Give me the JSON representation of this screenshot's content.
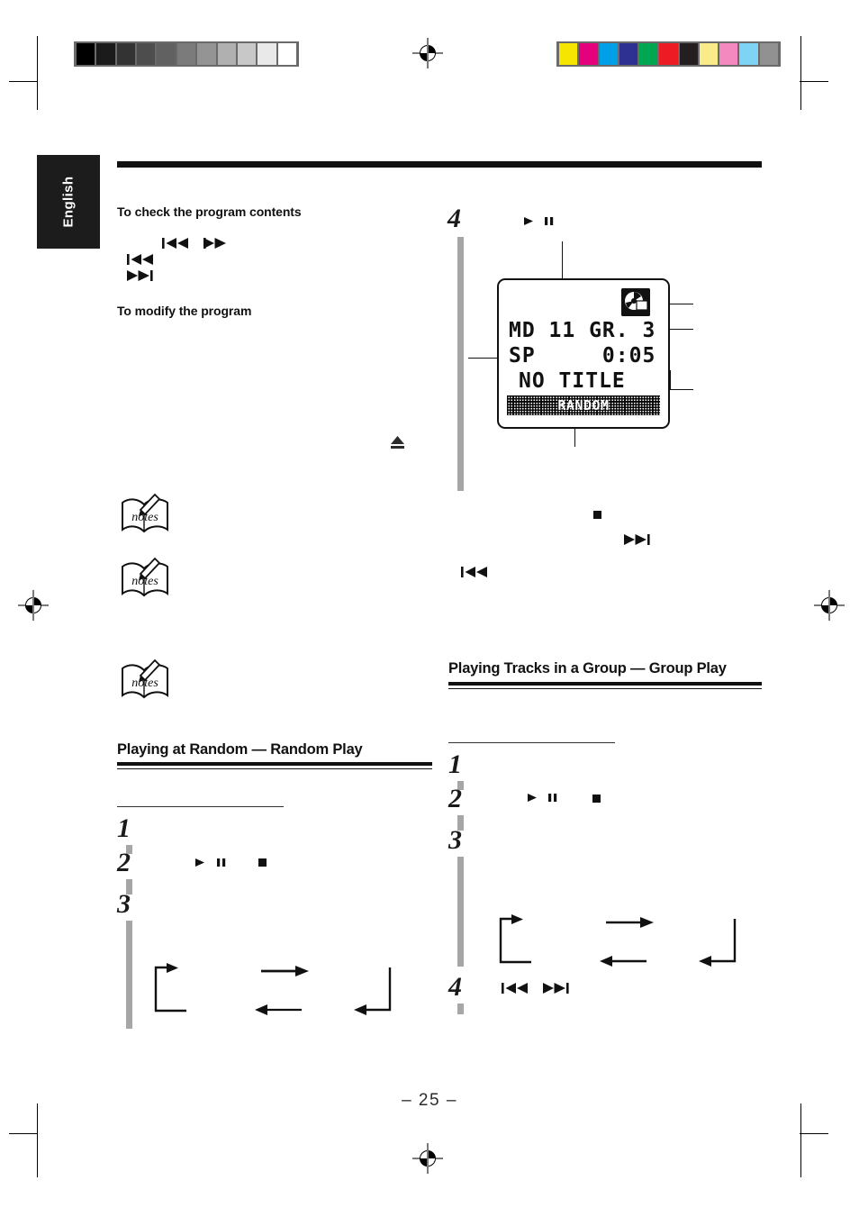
{
  "document": {
    "language_tab": "English",
    "page_number": "– 25 –"
  },
  "proof_marks": {
    "grayscale_steps": [
      "#000000",
      "#1b1b1b",
      "#333333",
      "#4d4d4d",
      "#616161",
      "#7b7b7b",
      "#949494",
      "#b0b0b0",
      "#c8c8c8",
      "#e9e9e9",
      "#ffffff"
    ],
    "color_steps": [
      "#f6e500",
      "#e5007d",
      "#00a0e9",
      "#2e3192",
      "#00a650",
      "#ed1c24",
      "#231f20",
      "#faeb8a",
      "#f489c0",
      "#7fd4f5",
      "#919191"
    ],
    "registration_icon": "registration-mark-icon"
  },
  "left_column": {
    "heading_check": "To check the program contents",
    "heading_modify": "To modify the program",
    "icons": {
      "prev_1": "skip-backward-icon",
      "next_1": "skip-forward-icon",
      "prev_2": "skip-backward-icon",
      "next_2": "skip-forward-icon",
      "eject": "eject-icon",
      "note_1": "notes-icon",
      "note_2": "notes-icon",
      "note_3": "notes-icon"
    },
    "section": {
      "title": "Playing at Random — Random Play",
      "steps": [
        "1",
        "2",
        "3"
      ],
      "step2_icons": [
        "play-icon",
        "pause-icon",
        "stop-icon"
      ]
    }
  },
  "right_column": {
    "step4_top": {
      "number": "4",
      "icons": [
        "play-icon",
        "pause-icon"
      ]
    },
    "mid_icons": {
      "stop": "stop-icon",
      "next": "skip-forward-icon",
      "prev": "skip-backward-icon"
    },
    "section": {
      "title": "Playing Tracks in a Group — Group Play",
      "steps": [
        "1",
        "2",
        "3",
        "4"
      ],
      "step2_icons": [
        "play-icon",
        "pause-icon",
        "stop-icon"
      ],
      "step4_icons": [
        "skip-backward-icon",
        "skip-forward-icon"
      ]
    }
  },
  "display": {
    "icon": "md-disc-icon",
    "line1": "MD 11 GR. 3",
    "line2": "SP     0:05",
    "line3": "NO TITLE",
    "indicator": "RANDOM"
  }
}
